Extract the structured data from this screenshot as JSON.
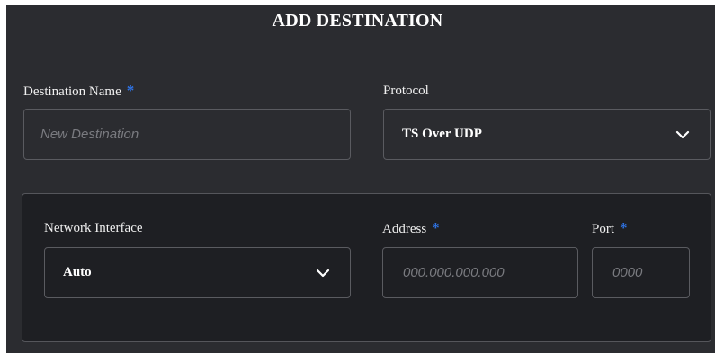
{
  "dialog": {
    "title": "ADD DESTINATION"
  },
  "destination_name": {
    "label": "Destination Name",
    "required_mark": "*",
    "placeholder": "New Destination",
    "value": ""
  },
  "protocol": {
    "label": "Protocol",
    "selected": "TS Over UDP",
    "icon": "chevron-down-icon"
  },
  "network_interface": {
    "label": "Network Interface",
    "selected": "Auto",
    "icon": "chevron-down-icon"
  },
  "address": {
    "label": "Address",
    "required_mark": "*",
    "placeholder": "000.000.000.000",
    "value": ""
  },
  "port": {
    "label": "Port",
    "required_mark": "*",
    "placeholder": "0000",
    "value": ""
  },
  "colors": {
    "background": "#2b2c30",
    "inner_panel": "#1e1f23",
    "border": "#5a5b60",
    "required_accent": "#2f74e6",
    "text": "#f0f0f0",
    "placeholder": "#7a7b80"
  }
}
